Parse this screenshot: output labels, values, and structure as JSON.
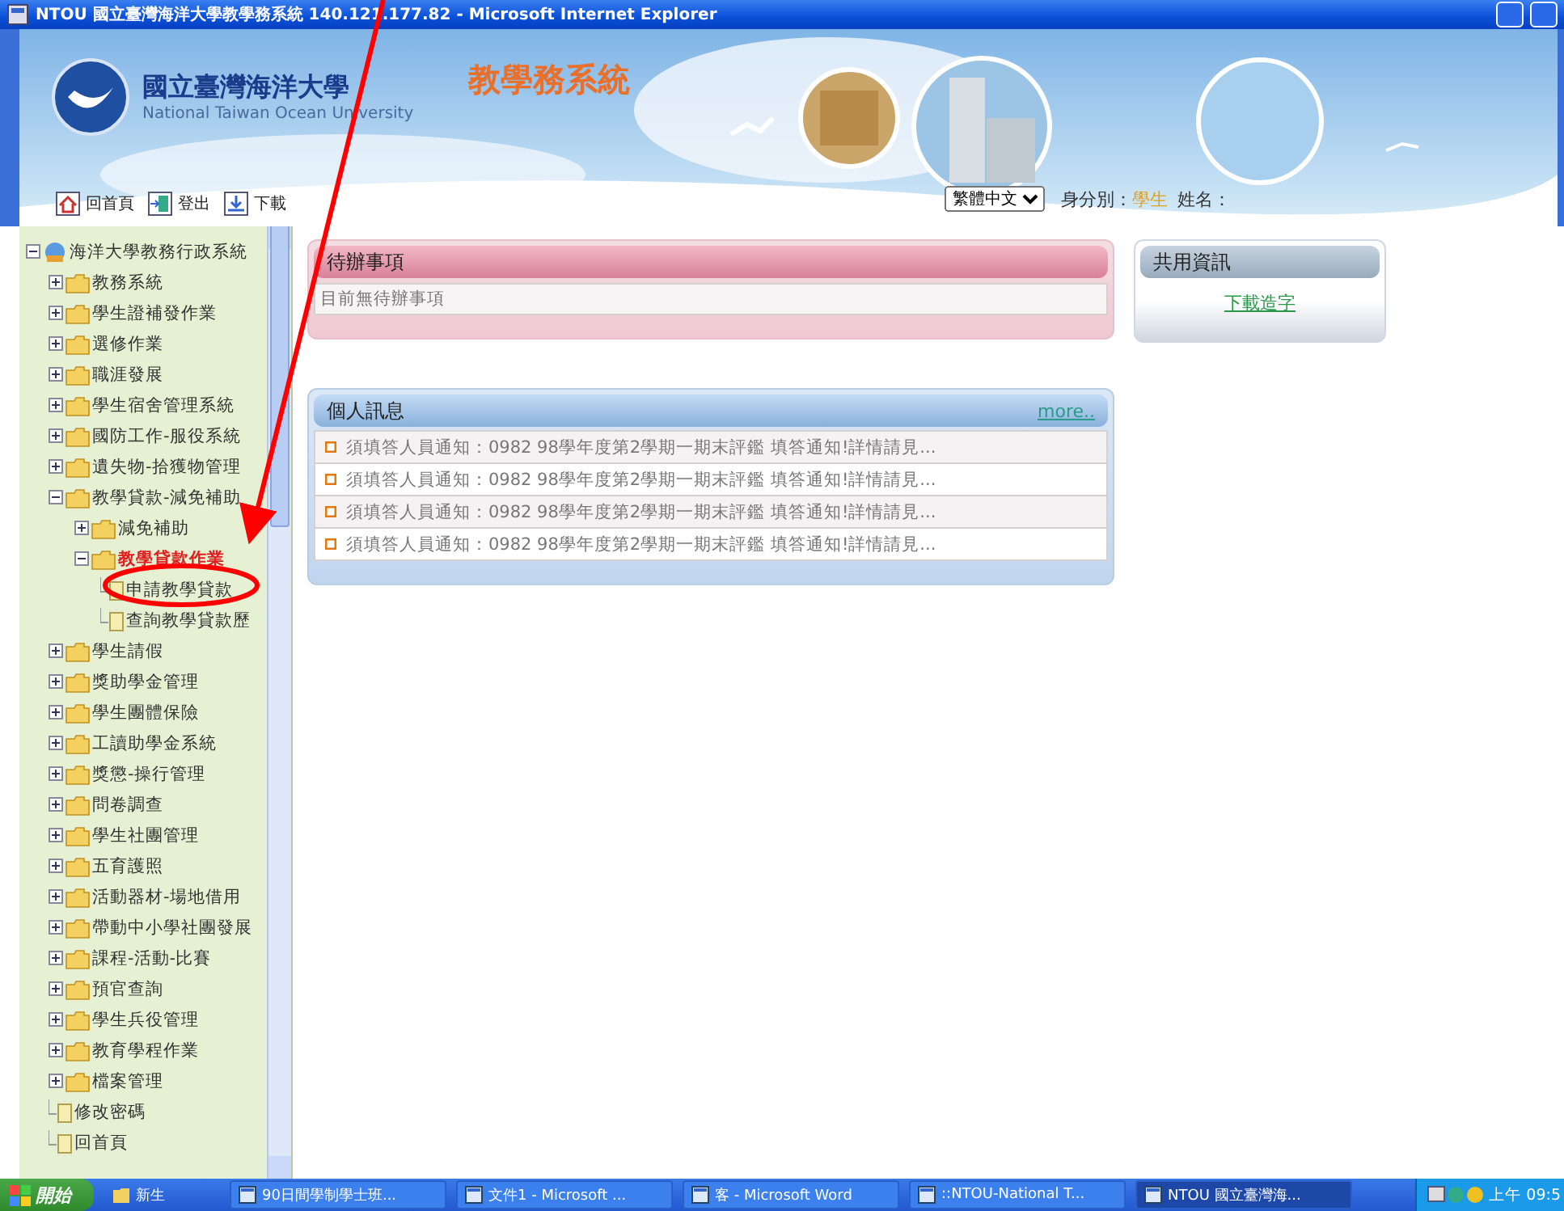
{
  "window": {
    "title": "NTOU 國立臺灣海洋大學教學務系統 140.121.177.82 - Microsoft Internet Explorer"
  },
  "header": {
    "university": "國立臺灣海洋大學",
    "university_en": "National Taiwan Ocean University",
    "system": "教學務系統",
    "toolbar": [
      "回首頁",
      "登出",
      "下載"
    ],
    "language": "繁體中文",
    "role_label": "身分別：",
    "role": "學生",
    "name_label": "姓名："
  },
  "tree": [
    {
      "label": "海洋大學教務行政系統",
      "kind": "root",
      "expanded": true,
      "selected": false,
      "children": [
        {
          "label": "教務系統",
          "kind": "folder",
          "expanded": false,
          "selected": false
        },
        {
          "label": "學生證補發作業",
          "kind": "folder",
          "expanded": false,
          "selected": false
        },
        {
          "label": "選修作業",
          "kind": "folder",
          "expanded": false,
          "selected": false
        },
        {
          "label": "職涯發展",
          "kind": "folder",
          "expanded": false,
          "selected": false
        },
        {
          "label": "學生宿舍管理系統",
          "kind": "folder",
          "expanded": false,
          "selected": false
        },
        {
          "label": "國防工作-服役系統",
          "kind": "folder",
          "expanded": false,
          "selected": false
        },
        {
          "label": "遺失物-拾獲物管理",
          "kind": "folder",
          "expanded": false,
          "selected": false
        },
        {
          "label": "教學貸款-減免補助",
          "kind": "folder",
          "expanded": true,
          "selected": false,
          "children": [
            {
              "label": "減免補助",
              "kind": "folder",
              "expanded": false,
              "selected": false
            },
            {
              "label": "教學貸款作業",
              "kind": "folder",
              "expanded": true,
              "selected": true,
              "children": [
                {
                  "label": "申請教學貸款",
                  "kind": "leaf",
                  "selected": false
                },
                {
                  "label": "查詢教學貸款歷",
                  "kind": "leaf",
                  "selected": false
                }
              ]
            }
          ]
        },
        {
          "label": "學生請假",
          "kind": "folder",
          "expanded": false,
          "selected": false
        },
        {
          "label": "獎助學金管理",
          "kind": "folder",
          "expanded": false,
          "selected": false
        },
        {
          "label": "學生團體保險",
          "kind": "folder",
          "expanded": false,
          "selected": false
        },
        {
          "label": "工讀助學金系統",
          "kind": "folder",
          "expanded": false,
          "selected": false
        },
        {
          "label": "獎懲-操行管理",
          "kind": "folder",
          "expanded": false,
          "selected": false
        },
        {
          "label": "問卷調查",
          "kind": "folder",
          "expanded": false,
          "selected": false
        },
        {
          "label": "學生社團管理",
          "kind": "folder",
          "expanded": false,
          "selected": false
        },
        {
          "label": "五育護照",
          "kind": "folder",
          "expanded": false,
          "selected": false
        },
        {
          "label": "活動器材-場地借用",
          "kind": "folder",
          "expanded": false,
          "selected": false
        },
        {
          "label": "帶動中小學社團發展",
          "kind": "folder",
          "expanded": false,
          "selected": false
        },
        {
          "label": "課程-活動-比賽",
          "kind": "folder",
          "expanded": false,
          "selected": false
        },
        {
          "label": "預官查詢",
          "kind": "folder",
          "expanded": false,
          "selected": false
        },
        {
          "label": "學生兵役管理",
          "kind": "folder",
          "expanded": false,
          "selected": false
        },
        {
          "label": "教育學程作業",
          "kind": "folder",
          "expanded": false,
          "selected": false
        },
        {
          "label": "檔案管理",
          "kind": "folder",
          "expanded": false,
          "selected": false
        },
        {
          "label": "修改密碼",
          "kind": "leaf",
          "selected": false
        },
        {
          "label": "回首頁",
          "kind": "leaf",
          "selected": false
        }
      ]
    }
  ],
  "todo": {
    "title": "待辦事項",
    "message": "目前無待辦事項"
  },
  "shared": {
    "title": "共用資訊",
    "link": "下載造字"
  },
  "messages": {
    "title": "個人訊息",
    "more": "more..",
    "items": [
      "須填答人員通知：0982 98學年度第2學期一期末評鑑 填答通知!詳情請見...",
      "須填答人員通知：0982 98學年度第2學期一期末評鑑 填答通知!詳情請見...",
      "須填答人員通知：0982 98學年度第2學期一期末評鑑 填答通知!詳情請見...",
      "須填答人員通知：0982 98學年度第2學期一期末評鑑 填答通知!詳情請見..."
    ]
  },
  "taskbar": {
    "start": "開始",
    "tasks": [
      {
        "label": "新生",
        "selected": false
      },
      {
        "label": "90日間學制學士班...",
        "selected": false
      },
      {
        "label": "文件1 - Microsoft ...",
        "selected": false
      },
      {
        "label": "客 - Microsoft Word",
        "selected": false
      },
      {
        "label": "::NTOU-National T...",
        "selected": false
      },
      {
        "label": "NTOU 國立臺灣海...",
        "selected": true
      }
    ],
    "clock": "上午 09:5"
  }
}
